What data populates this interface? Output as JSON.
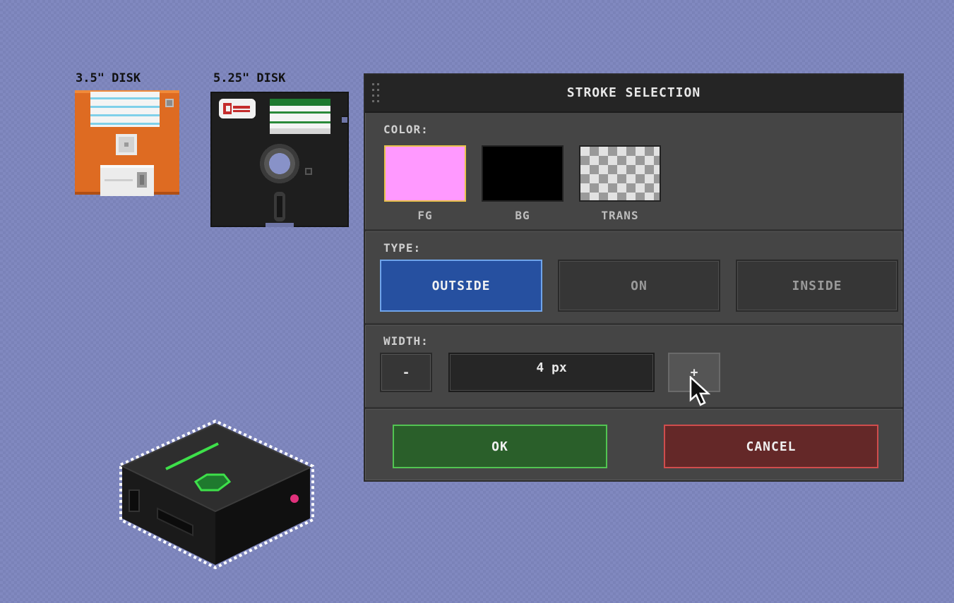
{
  "canvas": {
    "assets": [
      {
        "label": "3.5\" DISK",
        "icon": "floppy-35-icon"
      },
      {
        "label": "5.25\" DISK",
        "icon": "floppy-525-icon"
      },
      {
        "label": "",
        "icon": "iso-device-icon"
      }
    ],
    "background_colors": [
      "#8189c0",
      "#7a82b8"
    ]
  },
  "dialog": {
    "title": "STROKE SELECTION",
    "color": {
      "label": "COLOR:",
      "swatches": [
        {
          "label": "FG",
          "color": "#ff99ff",
          "selected": true
        },
        {
          "label": "BG",
          "color": "#000000",
          "selected": false
        },
        {
          "label": "TRANS",
          "color": "transparent",
          "selected": false
        }
      ]
    },
    "type": {
      "label": "TYPE:",
      "options": [
        {
          "label": "OUTSIDE",
          "active": true
        },
        {
          "label": "ON",
          "active": false
        },
        {
          "label": "INSIDE",
          "active": false
        }
      ]
    },
    "width": {
      "label": "WIDTH:",
      "decrement": "-",
      "value": "4 px",
      "increment": "+"
    },
    "actions": {
      "ok": "OK",
      "cancel": "CANCEL"
    },
    "colors": {
      "accent_active": "#2650a0",
      "ok": "#2a5f2a",
      "cancel": "#642828",
      "selection_border": "#e8c24a"
    }
  }
}
